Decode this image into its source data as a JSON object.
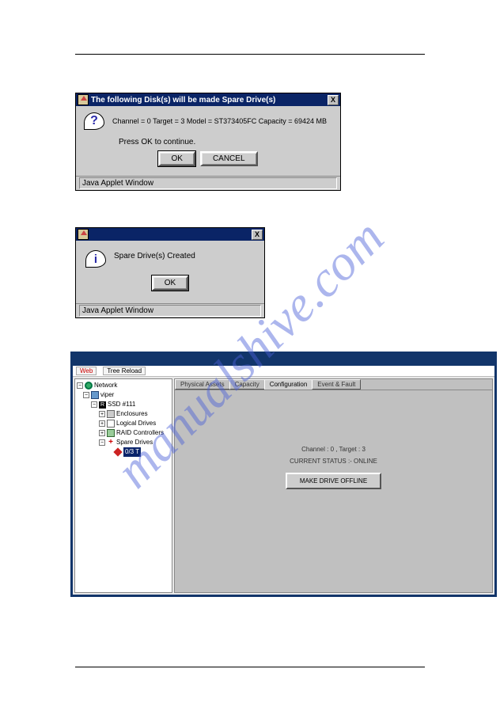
{
  "watermark": "manualshive.com",
  "dialog1": {
    "title": "The following Disk(s) will be made Spare Drive(s)",
    "close": "X",
    "message": "Channel = 0  Target = 3  Model = ST373405FC  Capacity = 69424 MB",
    "press": "Press OK to continue.",
    "ok": "OK",
    "cancel": "CANCEL",
    "status": "Java Applet Window"
  },
  "dialog2": {
    "close": "X",
    "message": "Spare Drive(s) Created",
    "ok": "OK",
    "status": "Java Applet Window"
  },
  "app": {
    "toolbar": {
      "web": "Web",
      "reload": "Tree Reload"
    },
    "tree": {
      "root": "Network",
      "host": "viper",
      "ssd": "SSD #111",
      "enclosures": "Enclosures",
      "logical": "Logical Drives",
      "raid": "RAID Controllers",
      "spare": "Spare Drives",
      "target": "0/3 T"
    },
    "tabs": {
      "physical": "Physical Assets",
      "capacity": "Capacity",
      "config": "Configuration",
      "event": "Event & Fault"
    },
    "content": {
      "channel": "Channel : 0 ,  Target : 3",
      "status": "CURRENT STATUS :-  ONLINE",
      "offline_btn": "MAKE DRIVE OFFLINE"
    }
  },
  "glyphs": {
    "minus": "−",
    "plus": "+"
  }
}
